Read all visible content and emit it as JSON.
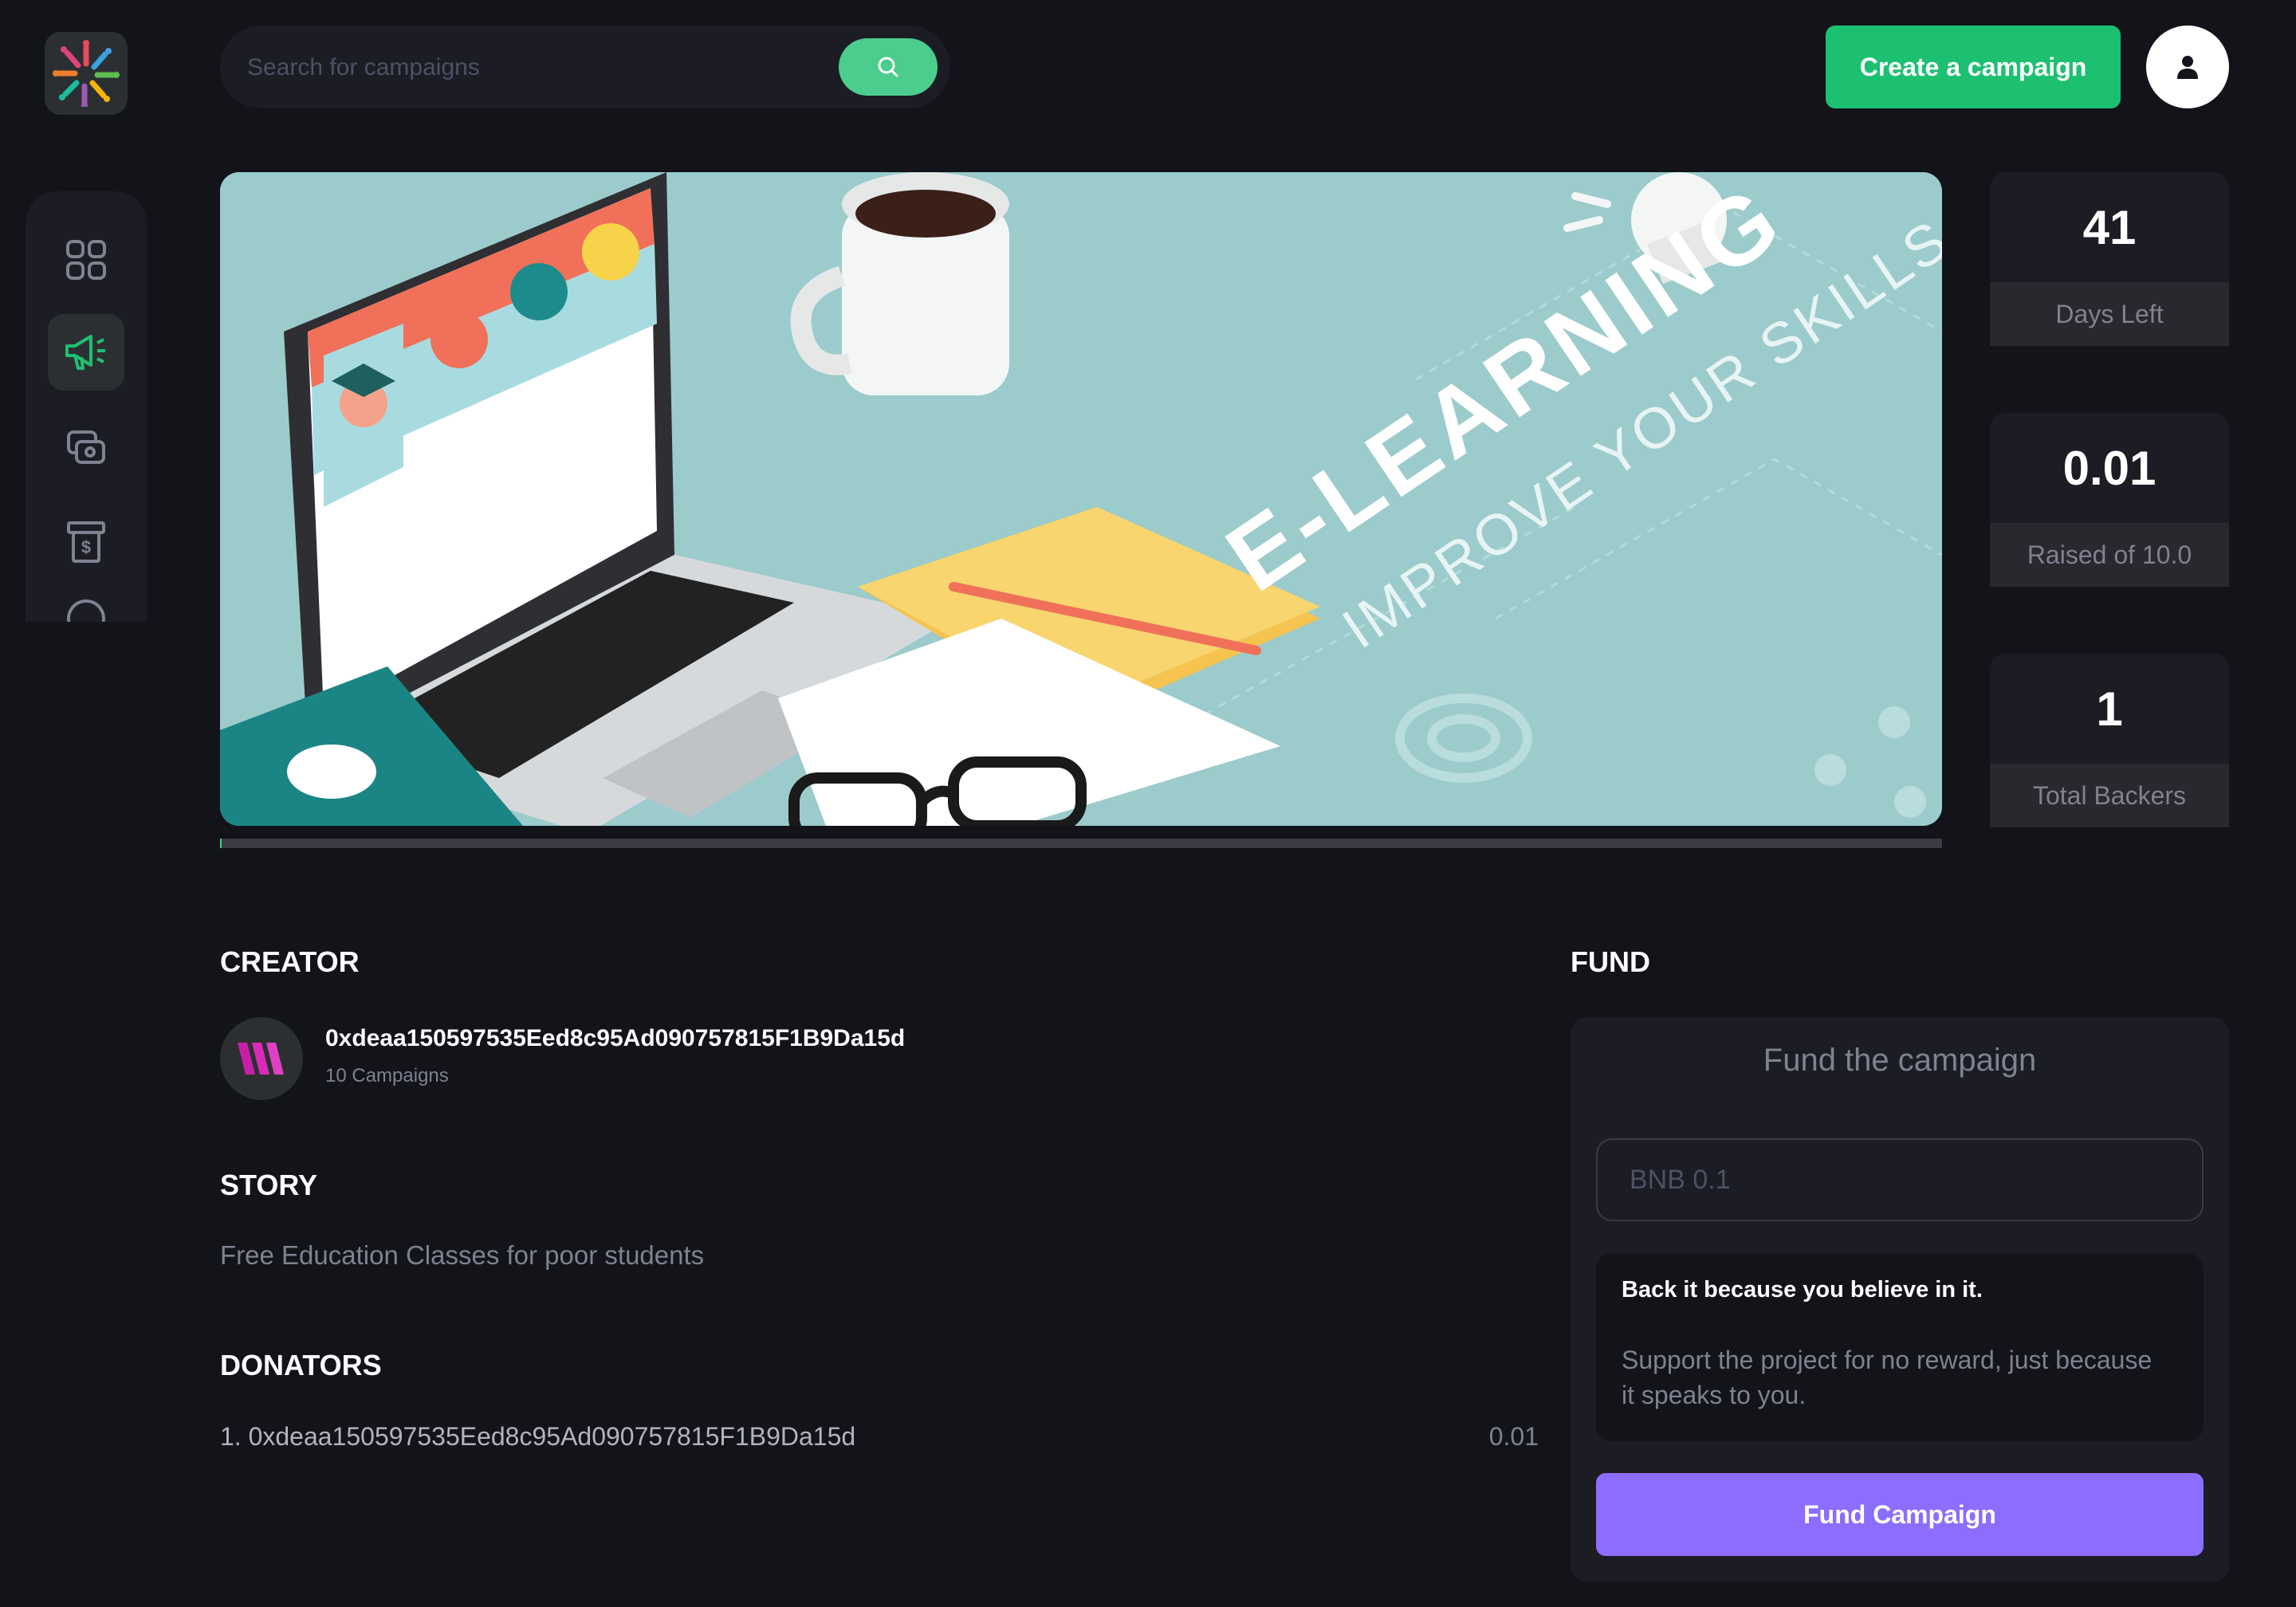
{
  "header": {
    "search_placeholder": "Search for campaigns",
    "create_label": "Create a campaign"
  },
  "sidebar": {
    "items": [
      "dashboard",
      "campaign",
      "payment",
      "withdraw"
    ],
    "active": "campaign"
  },
  "hero": {
    "title": "E-LEARNING",
    "subtitle": "IMPROVE YOUR SKILLS",
    "progress_fraction": 0.001
  },
  "stats": [
    {
      "value": "41",
      "label": "Days Left"
    },
    {
      "value": "0.01",
      "label": "Raised of 10.0"
    },
    {
      "value": "1",
      "label": "Total Backers"
    }
  ],
  "creator": {
    "title": "Creator",
    "address": "0xdeaa150597535Eed8c95Ad090757815F1B9Da15d",
    "campaigns": "10 Campaigns"
  },
  "story": {
    "title": "Story",
    "text": "Free Education Classes for poor students"
  },
  "donators": {
    "title": "Donators",
    "rows": [
      {
        "label": "1. 0xdeaa150597535Eed8c95Ad090757815F1B9Da15d",
        "amount": "0.01"
      }
    ]
  },
  "fund": {
    "title": "Fund",
    "heading": "Fund the campaign",
    "placeholder": "BNB 0.1",
    "back_title": "Back it because you believe in it.",
    "back_text": "Support the project for no reward, just because it speaks to you.",
    "button": "Fund Campaign"
  },
  "colors": {
    "background": "#13131a",
    "panel": "#1c1c24",
    "green": "#1dc071",
    "search_green": "#4acd8d",
    "purple": "#8c6dfd",
    "muted": "#808191"
  }
}
